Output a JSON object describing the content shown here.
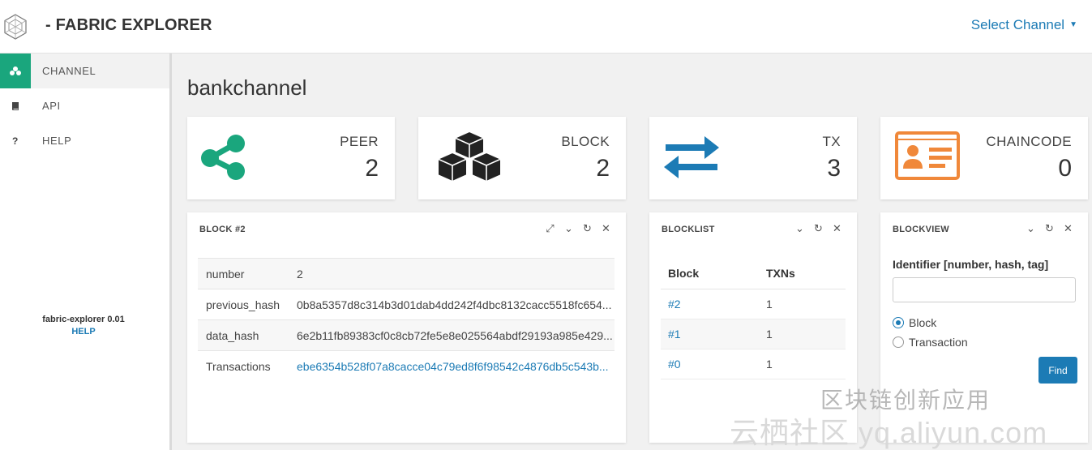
{
  "header": {
    "brand": "- FABRIC EXPLORER",
    "channel_select": "Select Channel"
  },
  "sidebar": {
    "items": [
      {
        "label": "CHANNEL",
        "icon": "network-icon"
      },
      {
        "label": "API",
        "icon": "book-icon"
      },
      {
        "label": "HELP",
        "icon": "question-icon",
        "glyph": "?"
      }
    ],
    "version": "fabric-explorer 0.01",
    "help_link": "HELP"
  },
  "page": {
    "title": "bankchannel"
  },
  "stats": [
    {
      "label": "PEER",
      "value": "2",
      "icon": "share-icon",
      "color": "#1aa67d"
    },
    {
      "label": "BLOCK",
      "value": "2",
      "icon": "cubes-icon",
      "color": "#222222"
    },
    {
      "label": "TX",
      "value": "3",
      "icon": "exchange-arrows-icon",
      "color": "#1c7bb5"
    },
    {
      "label": "CHAINCODE",
      "value": "0",
      "icon": "id-card-icon",
      "color": "#f0883a"
    }
  ],
  "block_panel": {
    "title": "BLOCK #2",
    "rows": [
      {
        "key": "number",
        "value": "2"
      },
      {
        "key": "previous_hash",
        "value": "0b8a5357d8c314b3d01dab4dd242f4dbc8132cacc5518fc654..."
      },
      {
        "key": "data_hash",
        "value": "6e2b11fb89383cf0c8cb72fe5e8e025564abdf29193a985e429..."
      },
      {
        "key": "Transactions",
        "value": "ebe6354b528f07a8cacce04c79ed8f6f98542c4876db5c543b..."
      }
    ]
  },
  "blocklist_panel": {
    "title": "BLOCKLIST",
    "headers": [
      "Block",
      "TXNs"
    ],
    "rows": [
      {
        "block": "#2",
        "txns": "1"
      },
      {
        "block": "#1",
        "txns": "1"
      },
      {
        "block": "#0",
        "txns": "1"
      }
    ]
  },
  "blockview_panel": {
    "title": "BLOCKVIEW",
    "identifier_label": "Identifier [number, hash, tag]",
    "identifier_value": "",
    "radio_block": "Block",
    "radio_transaction": "Transaction",
    "selected": "Block",
    "find_button": "Find"
  },
  "watermark": {
    "line1": "区块链创新应用",
    "line2": "云栖社区 yq.aliyun.com"
  },
  "colors": {
    "accent": "#1c7bb5",
    "green": "#1aa67d",
    "orange": "#f0883a"
  }
}
